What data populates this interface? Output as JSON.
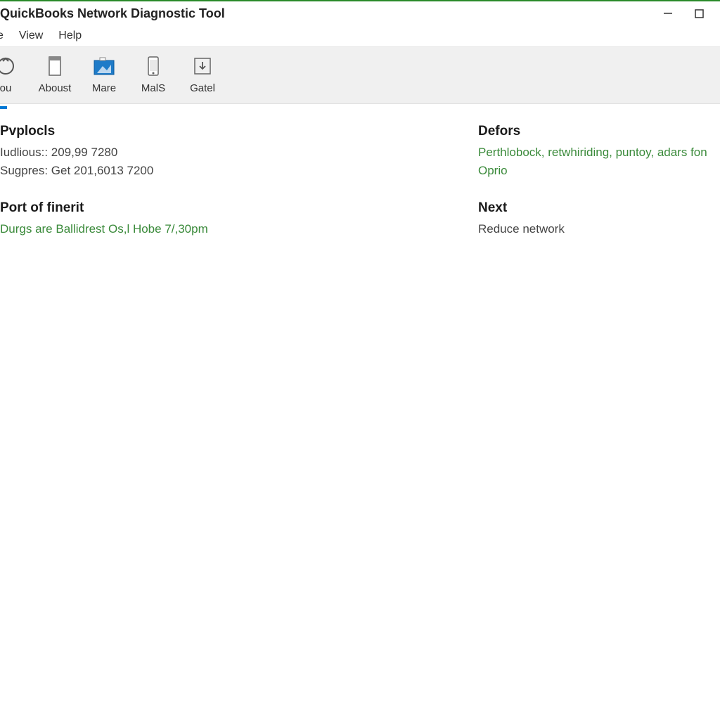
{
  "window": {
    "title": "QuickBooks Network Diagnostic Tool"
  },
  "menu": {
    "items": [
      "e",
      "View",
      "Help"
    ]
  },
  "toolbar": {
    "items": [
      {
        "label": "ou",
        "icon": "refresh-icon"
      },
      {
        "label": "Aboust",
        "icon": "page-icon"
      },
      {
        "label": "Mare",
        "icon": "picture-icon"
      },
      {
        "label": "MalS",
        "icon": "phone-icon"
      },
      {
        "label": "Gatel",
        "icon": "download-icon"
      }
    ]
  },
  "colors": {
    "accent": "#0078d4",
    "success": "#3a8a3a"
  },
  "sections": {
    "left": [
      {
        "title": "Pvplocls",
        "lines": [
          {
            "text": "Iudlious:: 209,99 7280",
            "green": false
          },
          {
            "text": "Sugpres: Get 201,6013 7200",
            "green": false
          }
        ]
      },
      {
        "title": "Port of finerit",
        "lines": [
          {
            "text": "Durgs are Ballidrest Os,l Hobe 7/,30pm",
            "green": true
          }
        ]
      }
    ],
    "right": [
      {
        "title": "Defors",
        "lines": [
          {
            "text": "Perthlobock, retwhiriding, puntoy, adars fon Oprio",
            "green": true
          }
        ]
      },
      {
        "title": "Next",
        "lines": [
          {
            "text": "Reduce network",
            "green": false
          }
        ]
      }
    ]
  }
}
